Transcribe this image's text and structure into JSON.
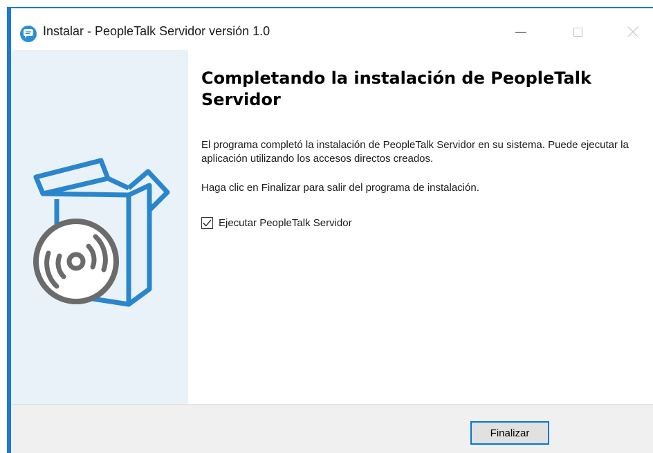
{
  "window": {
    "title": "Instalar - PeopleTalk Servidor versión 1.0",
    "accent_color": "#1e78d7",
    "app_icon": "chat-bubble-icon"
  },
  "titlebar_buttons": [
    "minimize",
    "maximize",
    "close"
  ],
  "sidebar": {
    "background": "#e9f2f9",
    "art_icon": "software-box-disc-icon"
  },
  "main": {
    "heading": "Completando la instalación de PeopleTalk Servidor",
    "paragraph1": "El programa completó la instalación de PeopleTalk Servidor en su sistema. Puede ejecutar la aplicación utilizando los accesos directos creados.",
    "paragraph2": "Haga clic en Finalizar para salir del programa de instalación.",
    "run_checkbox": {
      "label": "Ejecutar PeopleTalk Servidor",
      "checked": true
    }
  },
  "footer": {
    "finish_label": "Finalizar"
  }
}
